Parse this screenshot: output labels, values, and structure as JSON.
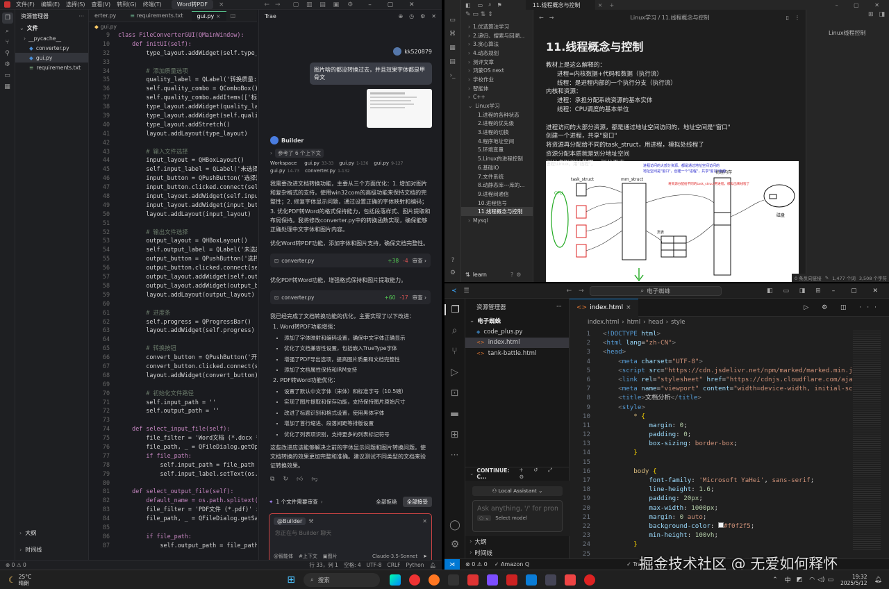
{
  "trae": {
    "menu": [
      "文件(F)",
      "编辑(E)",
      "选择(S)",
      "查看(V)",
      "转到(G)",
      "终端(T)"
    ],
    "project_tab": "Word转PDF",
    "search_placeholder": "搜索",
    "explorer_title": "资源管理器",
    "folder": "文件",
    "files": [
      "__pycache__",
      "converter.py",
      "gui.py",
      "requirements.txt"
    ],
    "outline": "大纲",
    "timeline": "时间线",
    "tabs": [
      "erter.py",
      "requirements.txt",
      "gui.py"
    ],
    "breadcrumb": "gui.py",
    "code": [
      {
        "n": "9",
        "t": "class FileConverterGUI(QMainWindow):      QF"
      },
      {
        "n": "10",
        "t": "    def initUI(self):"
      },
      {
        "n": "32",
        "t": "        type_layout.addWidget(self.type_comb"
      },
      {
        "n": "33",
        "t": ""
      },
      {
        "n": "34",
        "t": "        # 添加质量选项"
      },
      {
        "n": "35",
        "t": "        quality_label = QLabel('转换质量: ')"
      },
      {
        "n": "36",
        "t": "        self.quality_combo = QComboBox()"
      },
      {
        "n": "37",
        "t": "        self.quality_combo.addItems(['标准质量"
      },
      {
        "n": "38",
        "t": "        type_layout.addWidget(quality_label)"
      },
      {
        "n": "39",
        "t": "        type_layout.addWidget(self.quality_c"
      },
      {
        "n": "40",
        "t": "        type_layout.addStretch()"
      },
      {
        "n": "41",
        "t": "        layout.addLayout(type_layout)"
      },
      {
        "n": "42",
        "t": ""
      },
      {
        "n": "43",
        "t": "        # 输入文件选择"
      },
      {
        "n": "44",
        "t": "        input_layout = QHBoxLayout()"
      },
      {
        "n": "45",
        "t": "        self.input_label = QLabel('未选择文件"
      },
      {
        "n": "46",
        "t": "        input_button = QPushButton('选择源文件"
      },
      {
        "n": "47",
        "t": "        input_button.clicked.connect(self.se"
      },
      {
        "n": "48",
        "t": "        input_layout.addWidget(self.input_la"
      },
      {
        "n": "49",
        "t": "        input_layout.addWidget(input_button)"
      },
      {
        "n": "50",
        "t": "        layout.addLayout(input_layout)"
      },
      {
        "n": "51",
        "t": ""
      },
      {
        "n": "52",
        "t": "        # 输出文件选择"
      },
      {
        "n": "53",
        "t": "        output_layout = QHBoxLayout()"
      },
      {
        "n": "54",
        "t": "        self.output_label = QLabel('未选择文件"
      },
      {
        "n": "55",
        "t": "        output_button = QPushButton('选择保存"
      },
      {
        "n": "56",
        "t": "        output_button.clicked.connect(self.s"
      },
      {
        "n": "57",
        "t": "        output_layout.addWidget(self.output_"
      },
      {
        "n": "58",
        "t": "        output_layout.addWidget(output_butto"
      },
      {
        "n": "59",
        "t": "        layout.addLayout(output_layout)"
      },
      {
        "n": "60",
        "t": ""
      },
      {
        "n": "61",
        "t": "        # 进度条"
      },
      {
        "n": "62",
        "t": "        self.progress = QProgressBar()"
      },
      {
        "n": "63",
        "t": "        layout.addWidget(self.progress)"
      },
      {
        "n": "64",
        "t": ""
      },
      {
        "n": "65",
        "t": "        # 转换按钮"
      },
      {
        "n": "66",
        "t": "        convert_button = QPushButton('开始转换"
      },
      {
        "n": "67",
        "t": "        convert_button.clicked.connect(sel"
      },
      {
        "n": "68",
        "t": "        layout.addWidget(convert_button)"
      },
      {
        "n": "69",
        "t": ""
      },
      {
        "n": "70",
        "t": "        # 初始化文件路径"
      },
      {
        "n": "71",
        "t": "        self.input_path = ''"
      },
      {
        "n": "72",
        "t": "        self.output_path = ''"
      },
      {
        "n": "73",
        "t": ""
      },
      {
        "n": "74",
        "t": "    def select_input_file(self):"
      },
      {
        "n": "75",
        "t": "        file_filter = 'Word文档 (*.docx *.do"
      },
      {
        "n": "76",
        "t": "        file_path, _ = QFileDialog.getOpenFi"
      },
      {
        "n": "77",
        "t": "        if file_path:"
      },
      {
        "n": "78",
        "t": "            self.input_path = file_path"
      },
      {
        "n": "79",
        "t": "            self.input_label.setText(os.path"
      },
      {
        "n": "80",
        "t": ""
      },
      {
        "n": "81",
        "t": "    def select_output_file(self):"
      },
      {
        "n": "82",
        "t": "        default_name = os.path.splitext(os.p"
      },
      {
        "n": "83",
        "t": "        file_filter = 'PDF文件 (*.pdf)' if se"
      },
      {
        "n": "84",
        "t": "        file_path, _ = QFileDialog.getSaveFi"
      },
      {
        "n": "85",
        "t": ""
      },
      {
        "n": "86",
        "t": "        if file_path:"
      },
      {
        "n": "87",
        "t": "            self.output_path = file_path"
      }
    ],
    "chat": {
      "title": "Trae",
      "user": "kk520879",
      "user_msg": "图片啥的都没转换过去，并且效果字体都是甲骨文",
      "agent": "Builder",
      "ref_label": "参考了 6 个上下文",
      "refs": [
        {
          "name": "Workspace",
          "range": ""
        },
        {
          "name": "gui.py",
          "range": "33-33"
        },
        {
          "name": "gui.py",
          "range": "1-136"
        },
        {
          "name": "gui.py",
          "range": "9-127"
        },
        {
          "name": "gui.py",
          "range": "14-73"
        },
        {
          "name": "converter.py",
          "range": "1-132"
        }
      ],
      "para1": "我需要改进文档转换功能，主要从三个方面优化：1. 增加对图片和复杂格式的支持，使用win32com的高级功能来保持文档的完整性；2. 修复字体显示问题，通过设置正确的字体映射和编码；3. 优化PDF转Word的格式保持能力，包括段落样式、图片提取和布局保持。我将修改converter.py中的转换函数实现，确保能够正确处理中文字体和图片内容。",
      "para2": "优化Word转PDF功能，添加字体和图片支持，确保文档完整性。",
      "file1": {
        "name": "converter.py",
        "add": "+38",
        "del": "-4",
        "action": "审查"
      },
      "para3": "优化PDF转Word功能，增强格式保持和图片提取能力。",
      "file2": {
        "name": "converter.py",
        "add": "+60",
        "del": "-17",
        "action": "审查"
      },
      "para4": "我已经完成了文档转换功能的优化，主要实现了以下改进：",
      "sec1": "1. Word转PDF功能增强：",
      "sec1_items": [
        "添加了字体映射和编码设置，确保中文字体正确显示",
        "优化了文档兼容性设置，包括嵌入TrueType字体",
        "增强了PDF导出选项，提高图片质量和文档完整性",
        "添加了文档属性保持和IRM支持"
      ],
      "sec2": "2. PDF转Word功能优化：",
      "sec2_items": [
        "设置了默认中文字体（宋体）和标准字号（10.5磅）",
        "实现了图片提取和保存功能，支持保持图片原始尺寸",
        "改进了标题识别和格式设置，使用黑体字体",
        "增加了首行缩进、段落间距等排版设置",
        "优化了列表项识别，支持更多的列表标记符号"
      ],
      "para5": "这些改进应该能够解决之前的字体显示问题和图片转换问题，使文档转换的效果更加完整和准确。建议测试不同类型的文档来验证转换效果。",
      "review_bar": "1 个文件需要审查",
      "reject_all": "全部拒绝",
      "accept_all": "全部接受",
      "mention": "@Builder",
      "input_placeholder": "您正在与 Builder 聊天",
      "tool1": "智能体",
      "tool2": "上下文",
      "tool3": "图片",
      "model": "Claude-3.5-Sonnet"
    },
    "status": {
      "pos": "行 33，列 1",
      "spaces": "空格: 4",
      "enc": "UTF-8",
      "eol": "CRLF",
      "lang": "Python",
      "errors": "0",
      "warnings": "0"
    }
  },
  "obsidian": {
    "tab": "11.线程概念与控制",
    "breadcrumb": "Linux学习 / 11.线程概念与控制",
    "right_title": "Linux线程控制",
    "tree": [
      "1.优选算法学习",
      "2.递归、搜索与回溯...",
      "3.贪心算法",
      "4.动态规划",
      "测评文章",
      "鸿蒙OS next",
      "学校作业",
      "智能体",
      "C++",
      "Linux学习",
      "1.进程的各种状态",
      "2.进程的优先级",
      "3.进程的切换",
      "4.程序地址空间",
      "5.环境变量",
      "5.Linux的进程控制",
      "6.基础IO",
      "7.文件系统",
      "8.动静态库---库的...",
      "9.进程间通信",
      "10.进程信号",
      "11.线程概念与控制",
      "Mysql"
    ],
    "vault": "learn",
    "heading": "11.线程概念与控制",
    "lines": [
      "教材上是这么解释的：",
      "进程=内核数据+代码和数据（执行流）",
      "线程：是进程内部的一个执行分支（执行流）",
      "内核和资源：",
      "进程：承担分配系统资源的基本实体",
      "线程：CPU调度的基本单位",
      "",
      "进程访问的大部分资源，都是通过地址空间访问的，地址空间是\"窗口\"",
      "创建一个进程，共享\"窗口\"",
      "将资源再分配给不同的task_struct，用进程，模拟处线程了",
      "资源分配本质就是划分地址空间",
      "划分虚拟地址范围->划分页表"
    ],
    "diagram": {
      "header": "进程\\Linux，用\"线程\"，",
      "task_struct": "task_struct",
      "mm_struct": "mm_struct",
      "page": "页表",
      "mem": "物理内存",
      "disk": "磁盘",
      "cpu": "CPU",
      "note1": "进程访问的大部分资源，都是通过地址空间访问的",
      "note2": "地址空间是\"窗口\"，创建一个\"进程\"，共享\"窗口\"资源",
      "note3": "将资源分配给不同的task_struct用进程，模拟出来线程了"
    },
    "status": {
      "backlinks": "0 条反向链接",
      "words": "1,477 个词",
      "chars": "3,508 个字符"
    }
  },
  "vscode": {
    "title": "电子蜘蛛",
    "explorer_title": "资源管理器",
    "folder": "电子蜘蛛",
    "files": [
      "code_plus.py",
      "index.html",
      "tank-battle.html"
    ],
    "tab": "index.html",
    "crumbs": [
      "index.html",
      "html",
      "head",
      "style"
    ],
    "continue_title": "CONTINUE: C...",
    "assistant_btn": "Local Assistant",
    "ask_placeholder": "Ask anything, '/' for prom",
    "select_model": "Select model",
    "outline": "大纲",
    "timeline": "时间线",
    "status": {
      "errors": "0",
      "warnings": "0",
      "aws": "Amazon Q",
      "trae": "Trae"
    },
    "code": [
      {
        "n": "1",
        "h": "<span style=\"color:#808080\">&lt;</span><span style=\"color:#569cd6\">!DOCTYPE</span> <span style=\"color:#9cdcfe\">html</span><span style=\"color:#808080\">&gt;</span>"
      },
      {
        "n": "2",
        "h": "<span style=\"color:#808080\">&lt;</span><span style=\"color:#569cd6\">html</span> <span style=\"color:#9cdcfe\">lang</span>=<span style=\"color:#ce9178\">\"zh-CN\"</span><span style=\"color:#808080\">&gt;</span>"
      },
      {
        "n": "3",
        "h": "<span style=\"color:#808080\">&lt;</span><span style=\"color:#569cd6\">head</span><span style=\"color:#808080\">&gt;</span>"
      },
      {
        "n": "4",
        "h": "    <span style=\"color:#808080\">&lt;</span><span style=\"color:#569cd6\">meta</span> <span style=\"color:#9cdcfe\">charset</span>=<span style=\"color:#ce9178\">\"UTF-8\"</span><span style=\"color:#808080\">&gt;</span>"
      },
      {
        "n": "5",
        "h": "    <span style=\"color:#808080\">&lt;</span><span style=\"color:#569cd6\">script</span> <span style=\"color:#9cdcfe\">src</span>=<span style=\"color:#ce9178\">\"https://cdn.jsdelivr.net/npm/marked/marked.min.j</span>"
      },
      {
        "n": "6",
        "h": "    <span style=\"color:#808080\">&lt;</span><span style=\"color:#569cd6\">link</span> <span style=\"color:#9cdcfe\">rel</span>=<span style=\"color:#ce9178\">\"stylesheet\"</span> <span style=\"color:#9cdcfe\">href</span>=<span style=\"color:#ce9178\">\"https://cdnjs.cloudflare.com/aja</span>"
      },
      {
        "n": "7",
        "h": "    <span style=\"color:#808080\">&lt;</span><span style=\"color:#569cd6\">meta</span> <span style=\"color:#9cdcfe\">name</span>=<span style=\"color:#ce9178\">\"viewport\"</span> <span style=\"color:#9cdcfe\">content</span>=<span style=\"color:#ce9178\">\"width=device-width, initial-sc</span>"
      },
      {
        "n": "8",
        "h": "    <span style=\"color:#808080\">&lt;</span><span style=\"color:#569cd6\">title</span><span style=\"color:#808080\">&gt;</span>文档分析<span style=\"color:#808080\">&lt;/</span><span style=\"color:#569cd6\">title</span><span style=\"color:#808080\">&gt;</span>"
      },
      {
        "n": "9",
        "h": "    <span style=\"color:#808080\">&lt;</span><span style=\"color:#569cd6\">style</span><span style=\"color:#808080\">&gt;</span>"
      },
      {
        "n": "10",
        "h": "        <span style=\"color:#d7ba7d\">*</span> <span style=\"color:#ffd700\">{</span>"
      },
      {
        "n": "11",
        "h": "            <span style=\"color:#9cdcfe\">margin</span>: <span style=\"color:#b5cea8\">0</span>;"
      },
      {
        "n": "12",
        "h": "            <span style=\"color:#9cdcfe\">padding</span>: <span style=\"color:#b5cea8\">0</span>;"
      },
      {
        "n": "13",
        "h": "            <span style=\"color:#9cdcfe\">box-sizing</span>: <span style=\"color:#ce9178\">border-box</span>;"
      },
      {
        "n": "14",
        "h": "        <span style=\"color:#ffd700\">}</span>"
      },
      {
        "n": "15",
        "h": ""
      },
      {
        "n": "16",
        "h": "        <span style=\"color:#d7ba7d\">body</span> <span style=\"color:#ffd700\">{</span>"
      },
      {
        "n": "17",
        "h": "            <span style=\"color:#9cdcfe\">font-family</span>: <span style=\"color:#ce9178\">'Microsoft YaHei'</span>, <span style=\"color:#ce9178\">sans-serif</span>;"
      },
      {
        "n": "18",
        "h": "            <span style=\"color:#9cdcfe\">line-height</span>: <span style=\"color:#b5cea8\">1.6</span>;"
      },
      {
        "n": "19",
        "h": "            <span style=\"color:#9cdcfe\">padding</span>: <span style=\"color:#b5cea8\">20px</span>;"
      },
      {
        "n": "20",
        "h": "            <span style=\"color:#9cdcfe\">max-width</span>: <span style=\"color:#b5cea8\">1000px</span>;"
      },
      {
        "n": "21",
        "h": "            <span style=\"color:#9cdcfe\">margin</span>: <span style=\"color:#b5cea8\">0</span> <span style=\"color:#ce9178\">auto</span>;"
      },
      {
        "n": "22",
        "h": "            <span style=\"color:#9cdcfe\">background-color</span>: <span style=\"display:inline-block;width:8px;height:8px;background:#f0f2f5;border:1px solid #888\"></span><span style=\"color:#ce9178\">#f0f2f5</span>;"
      },
      {
        "n": "23",
        "h": "            <span style=\"color:#9cdcfe\">min-height</span>: <span style=\"color:#b5cea8\">100vh</span>;"
      },
      {
        "n": "24",
        "h": "        <span style=\"color:#ffd700\">}</span>"
      },
      {
        "n": "25",
        "h": ""
      }
    ]
  },
  "taskbar": {
    "temp": "25°C",
    "weather": "晴朗",
    "search": "搜索",
    "ime": "中",
    "time": "19:32",
    "date": "2025/5/12"
  },
  "watermark": "掘金技术社区 @ 无爱如何释怀"
}
